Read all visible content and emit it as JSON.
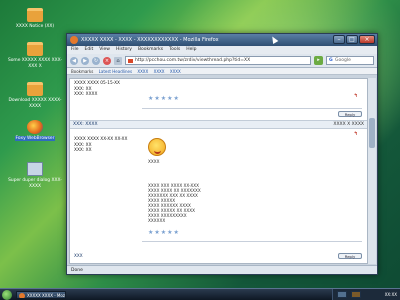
{
  "desktop": {
    "icons": [
      {
        "label": "XXXX Notice (XX)",
        "icon": "folder-icon"
      },
      {
        "label": "Some XXXXX XXXX XXX-XXX X",
        "icon": "archive-folder-icon"
      },
      {
        "label": "Download XXXXX XXXX-XXXX",
        "icon": "folder-icon"
      },
      {
        "label": "Foxy WebBrowser",
        "icon": "firefox-icon"
      },
      {
        "label": "Super duper dialog XXX-XXXX",
        "icon": "download-icon"
      }
    ]
  },
  "browser": {
    "title": "XXXXX XXXX - XXXX - XXXXXXXXXXXX - Mozilla Firefox",
    "menu": [
      "File",
      "Edit",
      "View",
      "History",
      "Bookmarks",
      "Tools",
      "Help"
    ],
    "url": "http://pcchou.com.tw/zrdiv/viewthread.php?tid=XX",
    "search_placeholder": "Google",
    "bookmarks_label": "Bookmarks",
    "bookmarks": [
      "Latest Headlines",
      "XXXX",
      "XXXX",
      "XXXX"
    ],
    "status": "Done"
  },
  "posts": [
    {
      "head": "",
      "head_right": "",
      "meta": [
        "XXXX XXXX 05-15-XX",
        "XXX: XX",
        "XXX: XXXX"
      ],
      "stars": "★★★★★",
      "reply_label": "Reply"
    },
    {
      "head": "XXX: XXXX",
      "head_right": "XXXX X XXXX",
      "meta": [
        "XXXX XXXX XX-XX XX-XX",
        "XXX: XX",
        "XXX: XX"
      ],
      "subject": "XXXX",
      "lines": [
        "XXXX XXX XXXX XX-XXX",
        "XXXX XXXX XX XXXXXXX",
        "XXXXXXX XXX XX XXXX",
        "XXXX XXXXX",
        "XXXX XXXXXX XXXX",
        "XXXX XXXXX XX XXXX",
        "XXXX XXXXXXXXX",
        "XXXXXX"
      ],
      "stars": "★★★★★",
      "reply_label": "Reply",
      "footer": "XXX"
    }
  ],
  "taskbar": {
    "items": [
      "XXXXX XXXX - Mozilla",
      "XXXX"
    ],
    "clock": "XX:XX"
  }
}
